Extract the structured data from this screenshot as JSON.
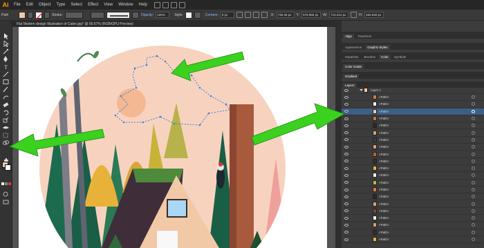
{
  "menu": {
    "logo": "Ai",
    "items": [
      "File",
      "Edit",
      "Object",
      "Type",
      "Select",
      "Effect",
      "View",
      "Window",
      "Help"
    ]
  },
  "controlbar": {
    "path_label": "Path",
    "stroke_label": "Stroke:",
    "opacity_label": "Opacity:",
    "opacity_value": "100%",
    "style_label": "Style:",
    "corners_label": "Corners:",
    "corners_value": "0 px",
    "x_value": "736.45 px",
    "y_value": "676.865 px",
    "w_value": "713.412 px",
    "h_value": "464.826 px"
  },
  "document": {
    "tab_title": "Flat Modern design Illustration of Cabin.jpg* @ 66.67% (RGB/GPU Preview)"
  },
  "panels": {
    "row1": [
      "Align",
      "Transform"
    ],
    "row2": [
      "Appearance",
      "Graphic Styles"
    ],
    "row3": [
      "Swatches",
      "Brushes",
      "Color",
      "Symbols"
    ],
    "row4": [
      "Color Guide"
    ],
    "row5": [
      "Gradient"
    ],
    "layers_title": "Layers",
    "layer_name": "Layer 1",
    "path_label": "<Path>"
  },
  "colors": {
    "arrow": "#3ad11f",
    "selection": "#3d7fd9",
    "sky": "#f7d3bf",
    "wall": "#f2c9a6",
    "trunk": "#a85a3c"
  }
}
